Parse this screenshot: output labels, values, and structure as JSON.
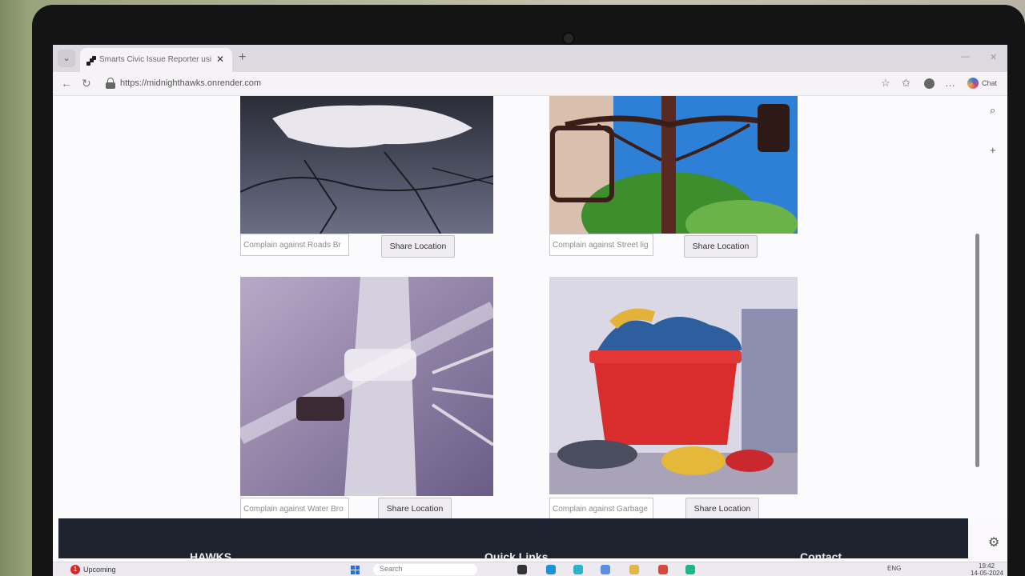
{
  "browser": {
    "tab_title": "Smarts Civic Issue Reporter using",
    "tab_close": "✕",
    "new_tab": "+",
    "url": "https://midnighthawks.onrender.com",
    "chat_label": "Chat"
  },
  "cards": [
    {
      "placeholder": "Complain against Roads Br",
      "button": "Share Location"
    },
    {
      "placeholder": "Complain against Street lig",
      "button": "Share Location"
    },
    {
      "placeholder": "Complain against Water Bro",
      "button": "Share Location"
    },
    {
      "placeholder": "Complain against Garbage",
      "button": "Share Location"
    }
  ],
  "footer": {
    "col1": "HAWKS",
    "col2": "Quick Links",
    "col3": "Contact"
  },
  "taskbar": {
    "badge": "1",
    "weather": "Upcoming",
    "search": "Search",
    "lang": "ENG",
    "time": "19:42",
    "date": "14-05-2024"
  },
  "colors": {
    "footer_bg": "#1d2430",
    "accent": "#2b6fd6"
  },
  "icons": {
    "back": "←",
    "reload": "↻",
    "star": "☆",
    "favorites": "✩",
    "more": "…",
    "search": "⌕",
    "plus": "+",
    "gear": "⚙",
    "chevron": "⌄"
  }
}
